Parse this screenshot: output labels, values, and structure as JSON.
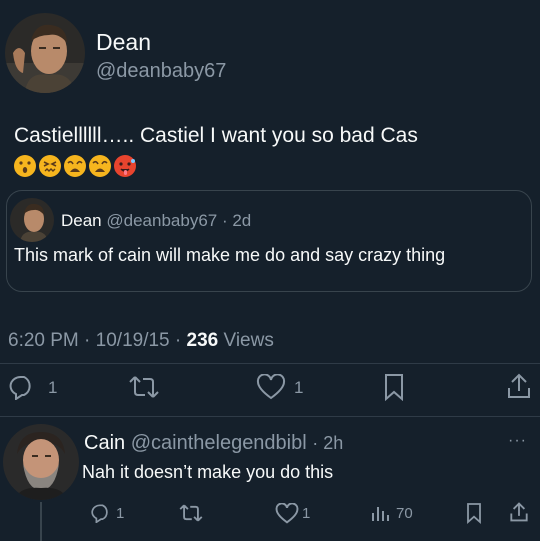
{
  "main_tweet": {
    "author_name": "Dean",
    "author_handle": "@deanbaby67",
    "text": "Castiellllll….. Castiel I want you so bad Cas",
    "emojis": [
      "hushed-face",
      "confounded-face",
      "weary-face",
      "weary-face",
      "hot-face"
    ],
    "quoted": {
      "author_name": "Dean",
      "author_handle": "@deanbaby67",
      "time": "· 2d",
      "text": "This mark of cain will make me do and say crazy thing"
    },
    "meta": {
      "time": "6:20 PM",
      "date": "· 10/19/15 ·",
      "views_count": "236",
      "views_label": "Views"
    },
    "actions": {
      "replies": "1",
      "likes": "1"
    }
  },
  "reply": {
    "author_name": "Cain",
    "author_handle": "@cainthelegendbibl",
    "time": "· 2h",
    "more": "···",
    "text": "Nah it doesn’t make you do this",
    "actions": {
      "replies": "1",
      "likes": "1",
      "views": "70"
    }
  },
  "colors": {
    "background": "#15202b",
    "text": "#f7f9f9",
    "muted": "#8b98a5",
    "divider": "#2f3b47"
  }
}
